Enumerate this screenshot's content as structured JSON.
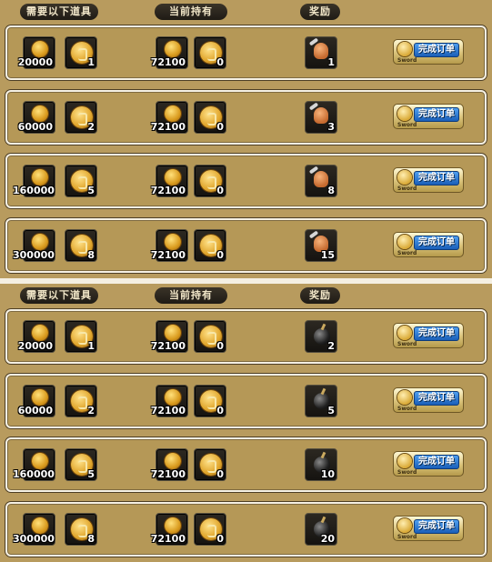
{
  "headers": {
    "required": "需要以下道具",
    "owned": "当前持有",
    "reward": "奖励"
  },
  "button": {
    "label": "完成订单",
    "sublabel": "Sword"
  },
  "icons": {
    "coin": "gold-coin-icon",
    "token": "gold-token-icon",
    "reward1": "doll-with-wrench-icon",
    "reward2": "bomb-icon"
  },
  "panels": [
    {
      "rows": [
        {
          "req_coin": "20000",
          "req_token": "1",
          "own_coin": "72100",
          "own_token": "0",
          "reward": "1"
        },
        {
          "req_coin": "60000",
          "req_token": "2",
          "own_coin": "72100",
          "own_token": "0",
          "reward": "3"
        },
        {
          "req_coin": "160000",
          "req_token": "5",
          "own_coin": "72100",
          "own_token": "0",
          "reward": "8"
        },
        {
          "req_coin": "300000",
          "req_token": "8",
          "own_coin": "72100",
          "own_token": "0",
          "reward": "15"
        }
      ]
    },
    {
      "rows": [
        {
          "req_coin": "20000",
          "req_token": "1",
          "own_coin": "72100",
          "own_token": "0",
          "reward": "2"
        },
        {
          "req_coin": "60000",
          "req_token": "2",
          "own_coin": "72100",
          "own_token": "0",
          "reward": "5"
        },
        {
          "req_coin": "160000",
          "req_token": "5",
          "own_coin": "72100",
          "own_token": "0",
          "reward": "10"
        },
        {
          "req_coin": "300000",
          "req_token": "8",
          "own_coin": "72100",
          "own_token": "0",
          "reward": "20"
        }
      ]
    }
  ]
}
